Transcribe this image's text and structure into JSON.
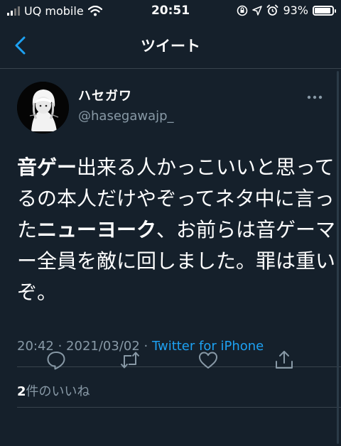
{
  "status_bar": {
    "carrier": "UQ mobile",
    "time": "20:51",
    "battery": "93%",
    "battery_level": 0.93,
    "icons": [
      "signal-icon",
      "wifi-icon",
      "orientation-lock-icon",
      "location-icon",
      "alarm-icon",
      "battery-icon"
    ]
  },
  "nav": {
    "back_icon": "chevron-left-icon",
    "title": "ツイート"
  },
  "tweet": {
    "author_name": "ハセガワ",
    "handle": "@hasegawajp_",
    "more_icon": "more-icon",
    "text": {
      "p1": "音ゲー",
      "p2": "出来る人かっこいいと思ってるの本人だけやぞってネタ中に言った",
      "p3": "ニューヨーク",
      "p4": "、お前らは音ゲーマー全員を敵に回しました。罪は重いぞ。"
    },
    "timestamp": "20:42 · 2021/03/02 · ",
    "source": "Twitter for iPhone",
    "like_count": "2",
    "like_label": "件のいいね"
  },
  "actions": {
    "reply": "reply-icon",
    "retweet": "retweet-icon",
    "like": "like-icon",
    "share": "share-icon"
  },
  "colors": {
    "background": "#15202b",
    "accent": "#1da1f2",
    "secondary_text": "#8899a6",
    "divider": "#38444d"
  }
}
